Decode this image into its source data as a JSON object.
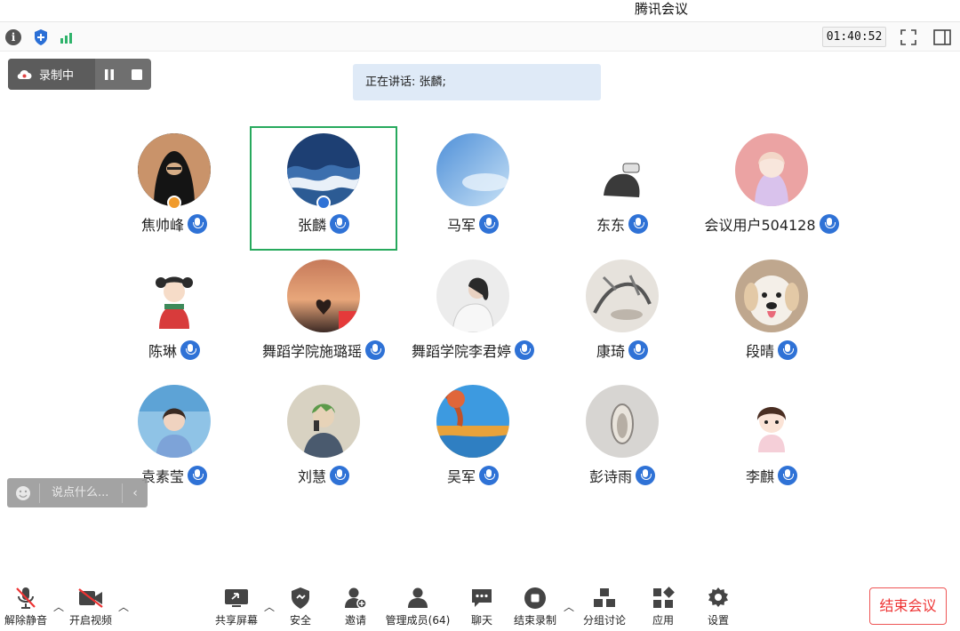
{
  "window": {
    "title": "腾讯会议"
  },
  "topbar": {
    "icons": [
      "info-icon",
      "shield-icon",
      "signal-icon",
      "fullscreen-icon",
      "sidebar-toggle-icon"
    ],
    "timer": "01:40:52"
  },
  "recording": {
    "status": "录制中"
  },
  "speaker": {
    "text": "正在讲话: 张麟;"
  },
  "participants": [
    {
      "name": "焦帅峰"
    },
    {
      "name": "张麟"
    },
    {
      "name": "马军"
    },
    {
      "name": "东东"
    },
    {
      "name": "会议用户504128"
    },
    {
      "name": "陈琳"
    },
    {
      "name": "舞蹈学院施璐瑶"
    },
    {
      "name": "舞蹈学院李君婷"
    },
    {
      "name": "康琦"
    },
    {
      "name": "段晴"
    },
    {
      "name": "袁素莹"
    },
    {
      "name": "刘慧"
    },
    {
      "name": "吴军"
    },
    {
      "name": "彭诗雨"
    },
    {
      "name": "李麒"
    }
  ],
  "chat": {
    "placeholder": "说点什么..."
  },
  "toolbar": {
    "unmute": "解除静音",
    "video": "开启视频",
    "share": "共享屏幕",
    "security": "安全",
    "invite": "邀请",
    "members": "管理成员(64)",
    "chat": "聊天",
    "stop_record": "结束录制",
    "breakout": "分组讨论",
    "apps": "应用",
    "settings": "设置",
    "end": "结束会议"
  },
  "colors": {
    "accent": "#2f72d6",
    "active_frame": "#27a95d",
    "end_red": "#e33333"
  }
}
